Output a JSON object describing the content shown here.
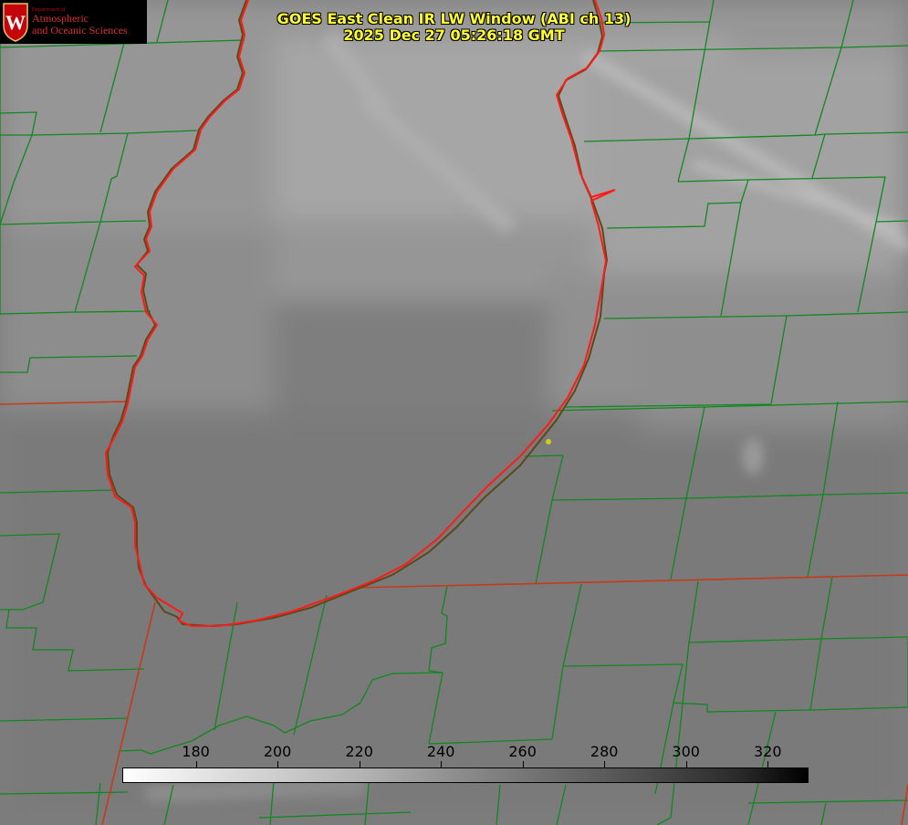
{
  "title_line1": "GOES East Clean IR LW Window (ABI ch 13)",
  "title_line2": "2025 Dec 27 05:26:18 GMT",
  "logo": {
    "department": "Department of",
    "name_line1": "Atmospheric",
    "name_line2": "and Oceanic Sciences",
    "seal_letter": "W"
  },
  "colorbar": {
    "ticks": [
      "180",
      "200",
      "220",
      "240",
      "260",
      "280",
      "300",
      "320"
    ],
    "min": 162,
    "max": 330
  },
  "colors": {
    "title": "#ffff33",
    "county_lines": "#11881f",
    "state_lines": "#c8391a",
    "coastline": "#ff1a1a",
    "marker": "#cccc22"
  }
}
